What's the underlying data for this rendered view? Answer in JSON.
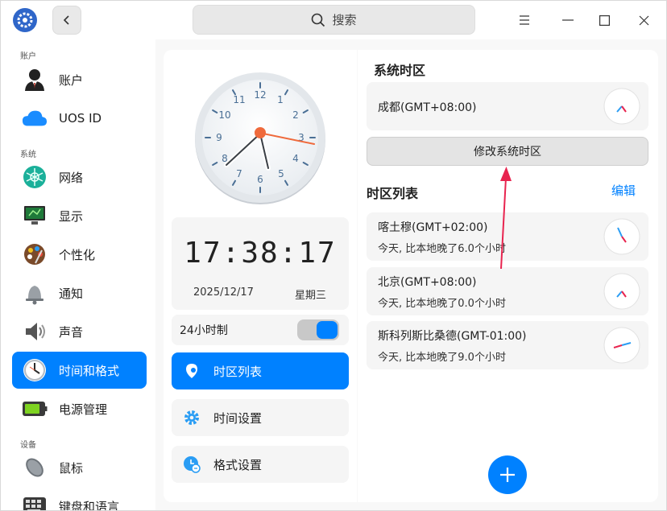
{
  "titlebar": {
    "search_label": "搜索"
  },
  "sidebar": {
    "sections": [
      {
        "label": "账户"
      },
      {
        "label": "系统"
      },
      {
        "label": "设备"
      }
    ],
    "items": [
      {
        "label": "账户",
        "icon": "account-icon"
      },
      {
        "label": "UOS ID",
        "icon": "cloud-icon"
      },
      {
        "label": "网络",
        "icon": "network-icon"
      },
      {
        "label": "显示",
        "icon": "display-icon"
      },
      {
        "label": "个性化",
        "icon": "palette-icon"
      },
      {
        "label": "通知",
        "icon": "bell-icon"
      },
      {
        "label": "声音",
        "icon": "speaker-icon"
      },
      {
        "label": "时间和格式",
        "icon": "clock-icon",
        "active": true
      },
      {
        "label": "电源管理",
        "icon": "battery-icon"
      },
      {
        "label": "鼠标",
        "icon": "mouse-icon"
      },
      {
        "label": "键盘和语言",
        "icon": "keyboard-icon"
      }
    ]
  },
  "clock": {
    "numerals": [
      "12",
      "1",
      "2",
      "3",
      "4",
      "5",
      "6",
      "7",
      "8",
      "9",
      "10",
      "11"
    ],
    "digital_time": "17:38:17",
    "date": "2025/12/17",
    "weekday": "星期三"
  },
  "settings": {
    "hour24_label": "24小时制",
    "hour24_on": true,
    "menu": [
      {
        "label": "时区列表",
        "icon": "location-pin-icon",
        "active": true
      },
      {
        "label": "时间设置",
        "icon": "gear-icon"
      },
      {
        "label": "格式设置",
        "icon": "format-clock-icon"
      }
    ]
  },
  "timezone": {
    "system_heading": "系统时区",
    "system_zone": "成都(GMT+08:00)",
    "change_button": "修改系统时区",
    "list_heading": "时区列表",
    "edit_label": "编辑",
    "zones": [
      {
        "city": "喀土穆(GMT+02:00)",
        "diff": "今天, 比本地晚了6.0个小时"
      },
      {
        "city": "北京(GMT+08:00)",
        "diff": "今天, 比本地晚了0.0个小时"
      },
      {
        "city": "斯科列斯比桑德(GMT-01:00)",
        "diff": "今天, 比本地晚了9.0个小时"
      }
    ]
  },
  "colors": {
    "accent": "#0081ff",
    "annotation_arrow": "#e8244f"
  }
}
